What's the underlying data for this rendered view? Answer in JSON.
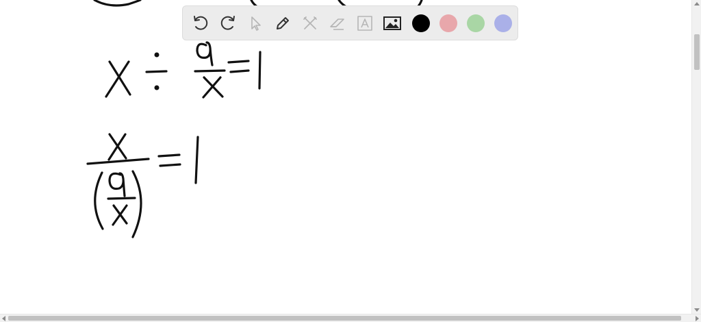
{
  "toolbar": {
    "tools": [
      {
        "name": "undo-icon"
      },
      {
        "name": "redo-icon"
      },
      {
        "name": "pointer-icon"
      },
      {
        "name": "pen-icon"
      },
      {
        "name": "tools-icon"
      },
      {
        "name": "eraser-icon"
      },
      {
        "name": "text-icon"
      },
      {
        "name": "image-icon"
      }
    ],
    "colors": [
      "#000000",
      "#e8a7ab",
      "#a9d6a5",
      "#aab0e8"
    ]
  },
  "canvas": {
    "ink_color": "#111111"
  }
}
